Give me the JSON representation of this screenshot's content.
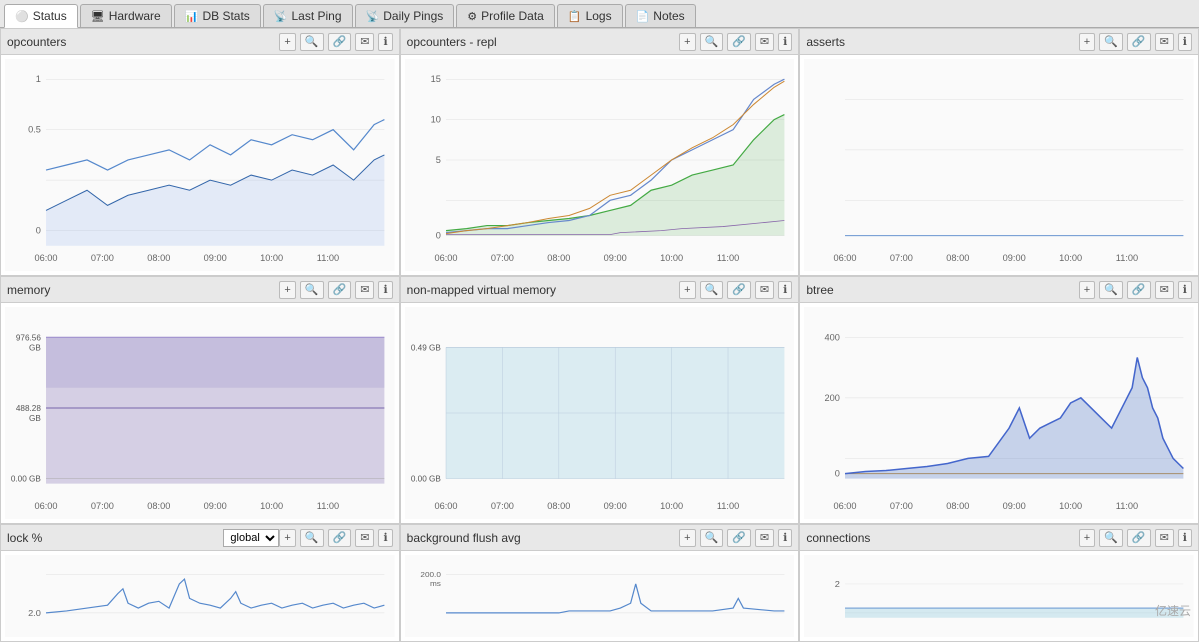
{
  "tabs": [
    {
      "id": "status",
      "label": "Status",
      "icon": "⚪",
      "active": true
    },
    {
      "id": "hardware",
      "label": "Hardware",
      "icon": "🖥"
    },
    {
      "id": "db-stats",
      "label": "DB Stats",
      "icon": "📊"
    },
    {
      "id": "last-ping",
      "label": "Last Ping",
      "icon": "📡"
    },
    {
      "id": "daily-pings",
      "label": "Daily Pings",
      "icon": "📡"
    },
    {
      "id": "profile-data",
      "label": "Profile Data",
      "icon": "⚙"
    },
    {
      "id": "logs",
      "label": "Logs",
      "icon": "📋"
    },
    {
      "id": "notes",
      "label": "Notes",
      "icon": "📄"
    }
  ],
  "panels": [
    {
      "id": "opcounters",
      "title": "opcounters",
      "row": 0,
      "col": 0,
      "chart_type": "opcounters"
    },
    {
      "id": "opcounters-repl",
      "title": "opcounters - repl",
      "row": 0,
      "col": 1,
      "chart_type": "opcounters_repl"
    },
    {
      "id": "asserts",
      "title": "asserts",
      "row": 0,
      "col": 2,
      "chart_type": "asserts"
    },
    {
      "id": "memory",
      "title": "memory",
      "row": 1,
      "col": 0,
      "chart_type": "memory"
    },
    {
      "id": "non-mapped",
      "title": "non-mapped virtual memory",
      "row": 1,
      "col": 1,
      "chart_type": "non_mapped"
    },
    {
      "id": "btree",
      "title": "btree",
      "row": 1,
      "col": 2,
      "chart_type": "btree"
    },
    {
      "id": "lock",
      "title": "lock %",
      "row": 2,
      "col": 0,
      "chart_type": "lock",
      "has_dropdown": true,
      "dropdown_value": "global"
    },
    {
      "id": "bg-flush",
      "title": "background flush avg",
      "row": 2,
      "col": 1,
      "chart_type": "bg_flush"
    },
    {
      "id": "connections",
      "title": "connections",
      "row": 2,
      "col": 2,
      "chart_type": "connections"
    }
  ],
  "actions": [
    "+",
    "🔍",
    "🔗",
    "✉",
    "ℹ"
  ],
  "time_labels": [
    "06:00",
    "07:00",
    "08:00",
    "09:00",
    "10:00",
    "11:00"
  ],
  "watermark": "亿速云"
}
